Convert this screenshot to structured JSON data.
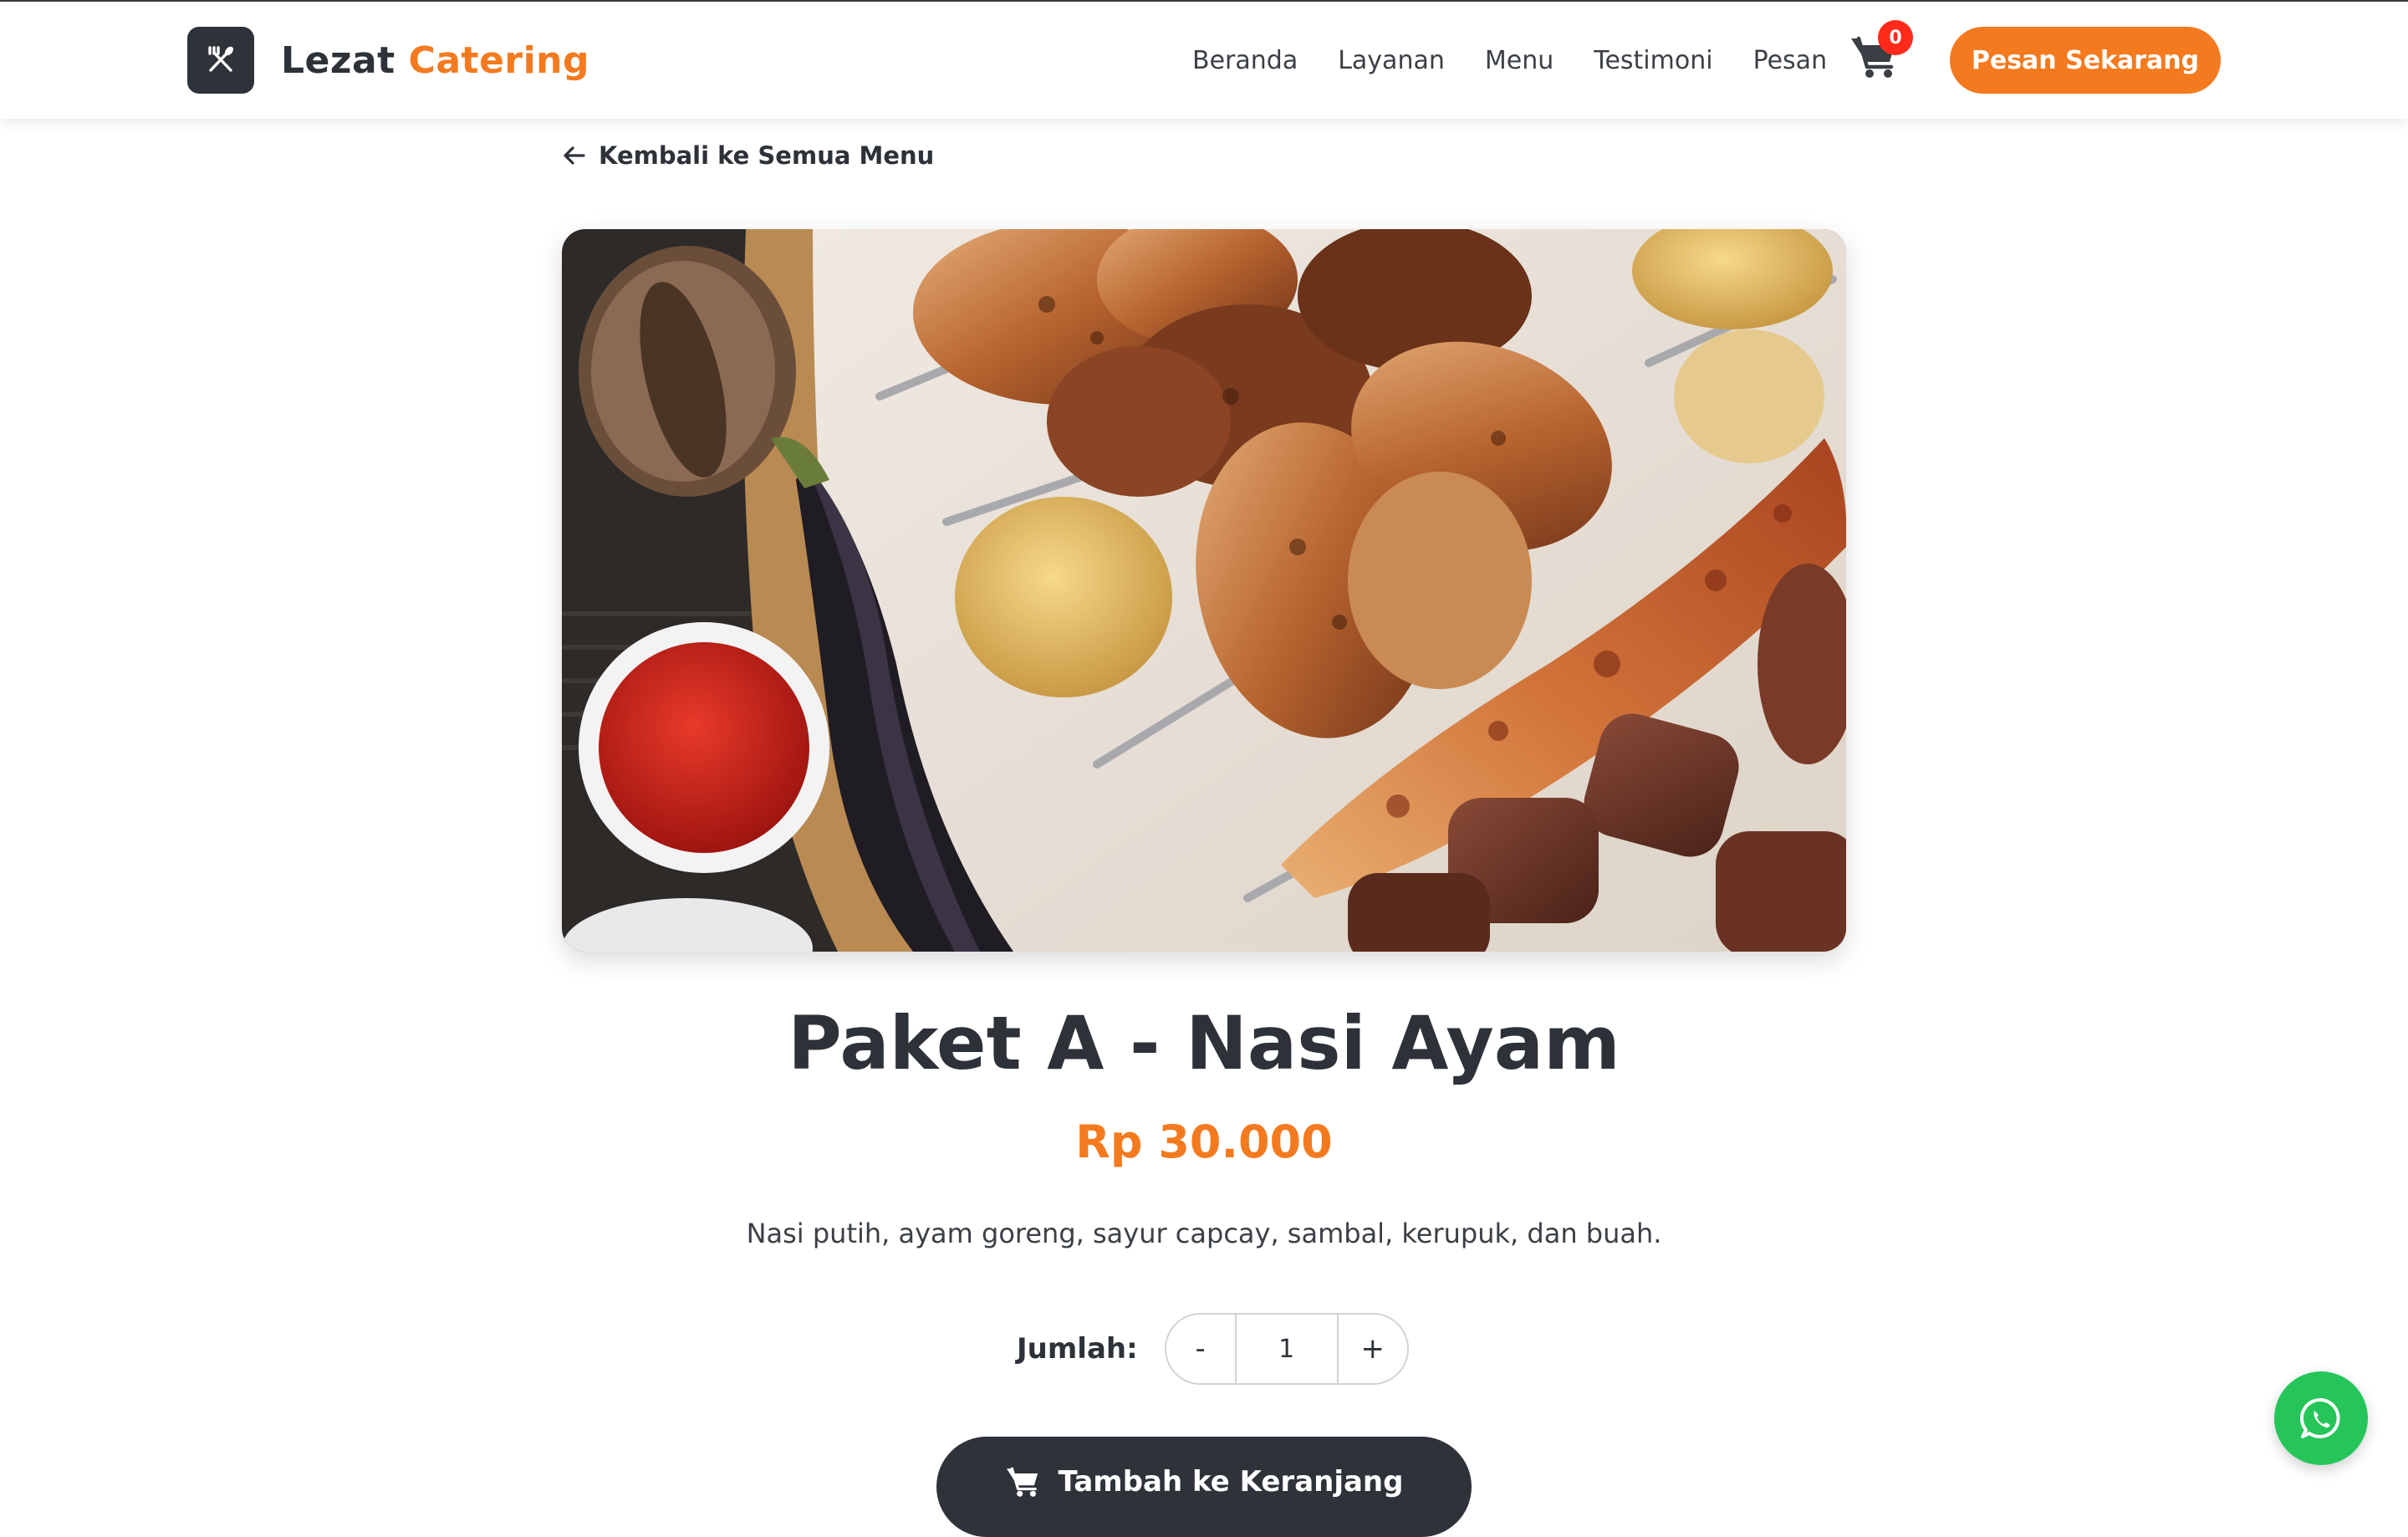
{
  "brand": {
    "name_part1": "Lezat",
    "name_part2": "Catering",
    "icon": "utensils-icon"
  },
  "nav": {
    "links": [
      "Beranda",
      "Layanan",
      "Menu",
      "Testimoni",
      "Pesan"
    ],
    "cart_count": "0",
    "cta_label": "Pesan Sekarang"
  },
  "back_link": "Kembali ke Semua Menu",
  "product": {
    "image": "grilled-meat-platter-photo",
    "title": "Paket A - Nasi Ayam",
    "price": "Rp 30.000",
    "description": "Nasi putih, ayam goreng, sayur capcay, sambal, kerupuk, dan buah."
  },
  "quantity": {
    "label": "Jumlah:",
    "minus": "-",
    "value": "1",
    "plus": "+"
  },
  "add_to_cart_label": "Tambah ke Keranjang",
  "colors": {
    "accent": "#f47a1f",
    "dark": "#2e333a",
    "badge": "#ff2a1a",
    "whatsapp": "#25c55a"
  }
}
